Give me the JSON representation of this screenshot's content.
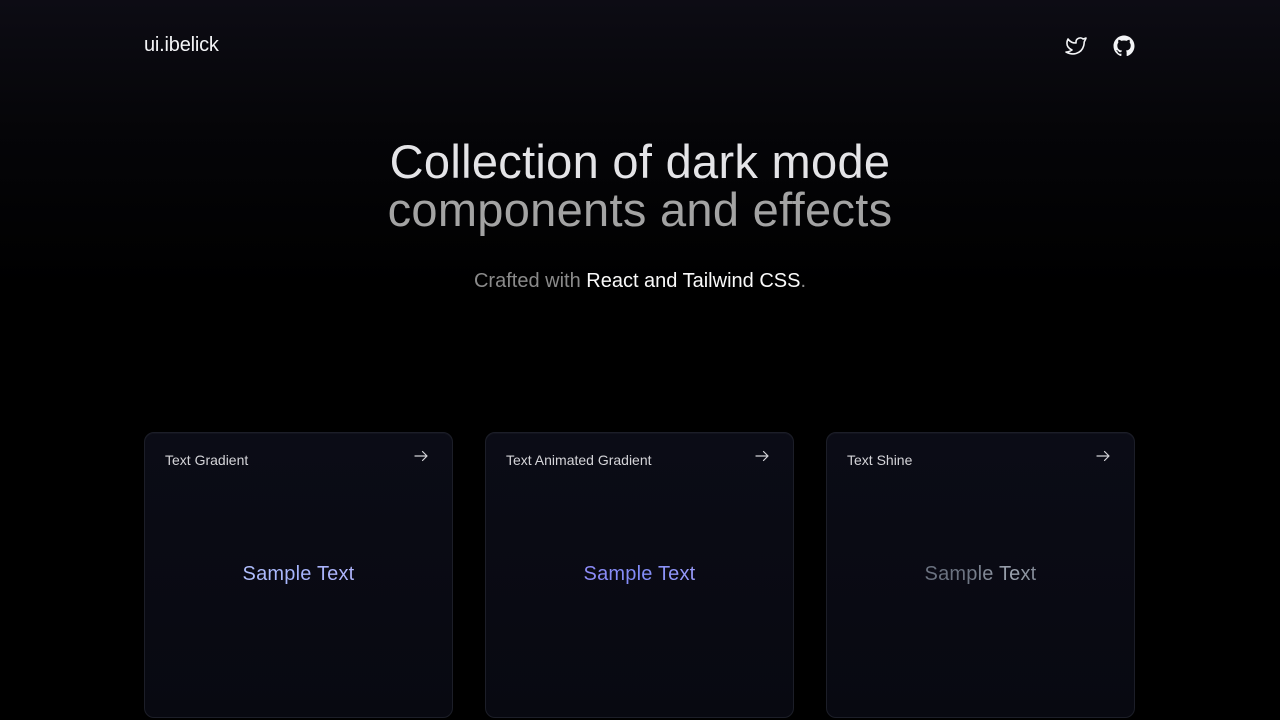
{
  "header": {
    "logo": "ui.ibelick",
    "icons": [
      "twitter-icon",
      "github-icon"
    ]
  },
  "hero": {
    "title_line1": "Collection of dark mode",
    "title_line2": "components and effects",
    "subtitle_prefix": "Crafted with ",
    "subtitle_highlight": "React and Tailwind CSS",
    "subtitle_suffix": "."
  },
  "cards": [
    {
      "title": "Text Gradient",
      "sample": "Sample Text",
      "icon": "arrow-right-icon"
    },
    {
      "title": "Text Animated Gradient",
      "sample": "Sample Text",
      "icon": "arrow-right-icon"
    },
    {
      "title": "Text Shine",
      "sample": "Sample Text",
      "icon": "arrow-right-icon"
    }
  ],
  "colors": {
    "background": "#000000",
    "card_border": "#1c1e28",
    "card_bg": "#0b0c16",
    "text_primary": "#f3f4f6",
    "text_muted": "#8a8a8a"
  }
}
